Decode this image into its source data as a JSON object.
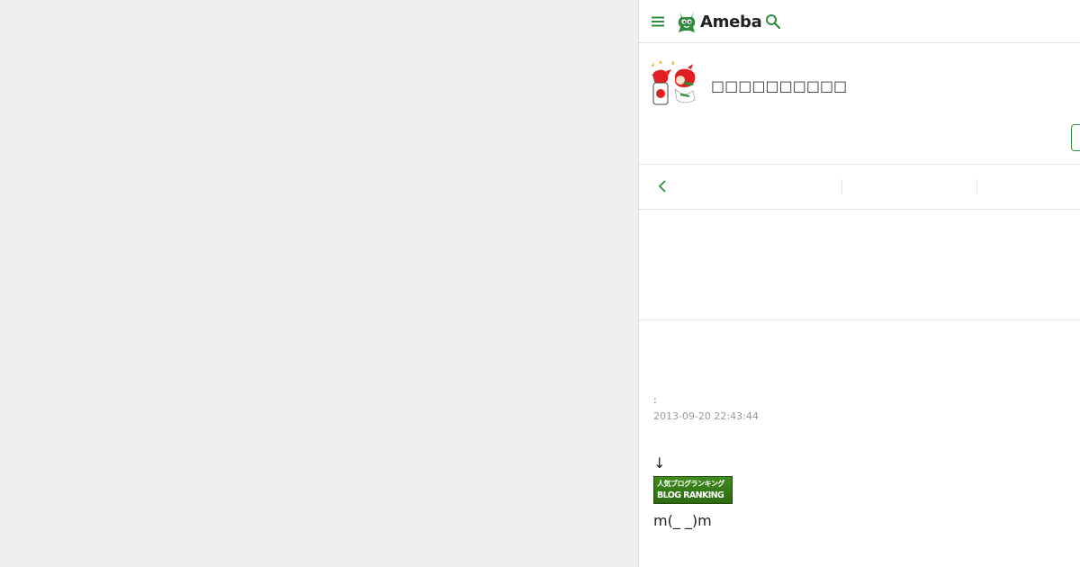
{
  "header": {
    "logo_text": "Ameba",
    "brand_color": "#2d8c3c",
    "menu_icon": "hamburger-menu-icon",
    "search_icon": "search-icon"
  },
  "profile": {
    "blog_title": "□□□□□□□□□□",
    "avatar_icon": "cartoon-avatar-with-flag"
  },
  "article": {
    "theme_label": ":",
    "date": "2013-09-20 22:43:44",
    "arrow": "↓",
    "banner_line1": "人気ブログランキング",
    "banner_line2": "BLOG RANKING",
    "emote": "m(_ _)m"
  }
}
